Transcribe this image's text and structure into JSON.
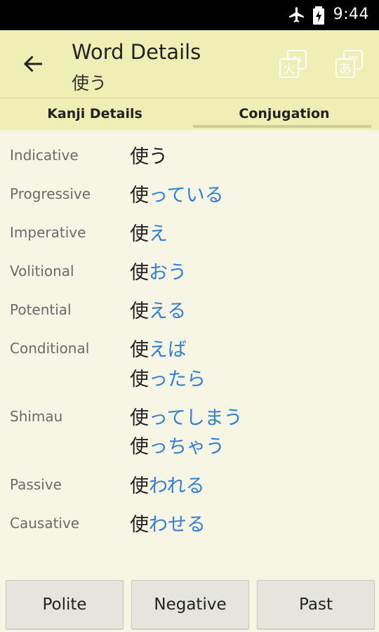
{
  "status": {
    "time": "9:44"
  },
  "appbar": {
    "title": "Word Details",
    "subtitle": "使う"
  },
  "tabs": [
    {
      "label": "Kanji Details"
    },
    {
      "label": "Conjugation"
    }
  ],
  "conjugations": [
    {
      "label": "Indicative",
      "forms": [
        {
          "stem": "使う",
          "ending": ""
        }
      ]
    },
    {
      "label": "Progressive",
      "forms": [
        {
          "stem": "使",
          "ending": "っている"
        }
      ]
    },
    {
      "label": "Imperative",
      "forms": [
        {
          "stem": "使",
          "ending": "え"
        }
      ]
    },
    {
      "label": "Volitional",
      "forms": [
        {
          "stem": "使",
          "ending": "おう"
        }
      ]
    },
    {
      "label": "Potential",
      "forms": [
        {
          "stem": "使",
          "ending": "える"
        }
      ]
    },
    {
      "label": "Conditional",
      "forms": [
        {
          "stem": "使",
          "ending": "えば"
        },
        {
          "stem": "使",
          "ending": "ったら"
        }
      ]
    },
    {
      "label": "Shimau",
      "forms": [
        {
          "stem": "使",
          "ending": "ってしまう"
        },
        {
          "stem": "使",
          "ending": "っちゃう"
        }
      ]
    },
    {
      "label": "Passive",
      "forms": [
        {
          "stem": "使",
          "ending": "われる"
        }
      ]
    },
    {
      "label": "Causative",
      "forms": [
        {
          "stem": "使",
          "ending": "わせる"
        }
      ]
    }
  ],
  "buttons": {
    "polite": "Polite",
    "negative": "Negative",
    "past": "Past"
  },
  "icons": {
    "kanji_button": "火",
    "kana_button": "あ",
    "kanji_button_small": "ひ",
    "kana_button_small": "ア"
  },
  "colors": {
    "ending": "#2f7fd6",
    "appbar": "#efeeb4",
    "background": "#f7f5e3"
  }
}
